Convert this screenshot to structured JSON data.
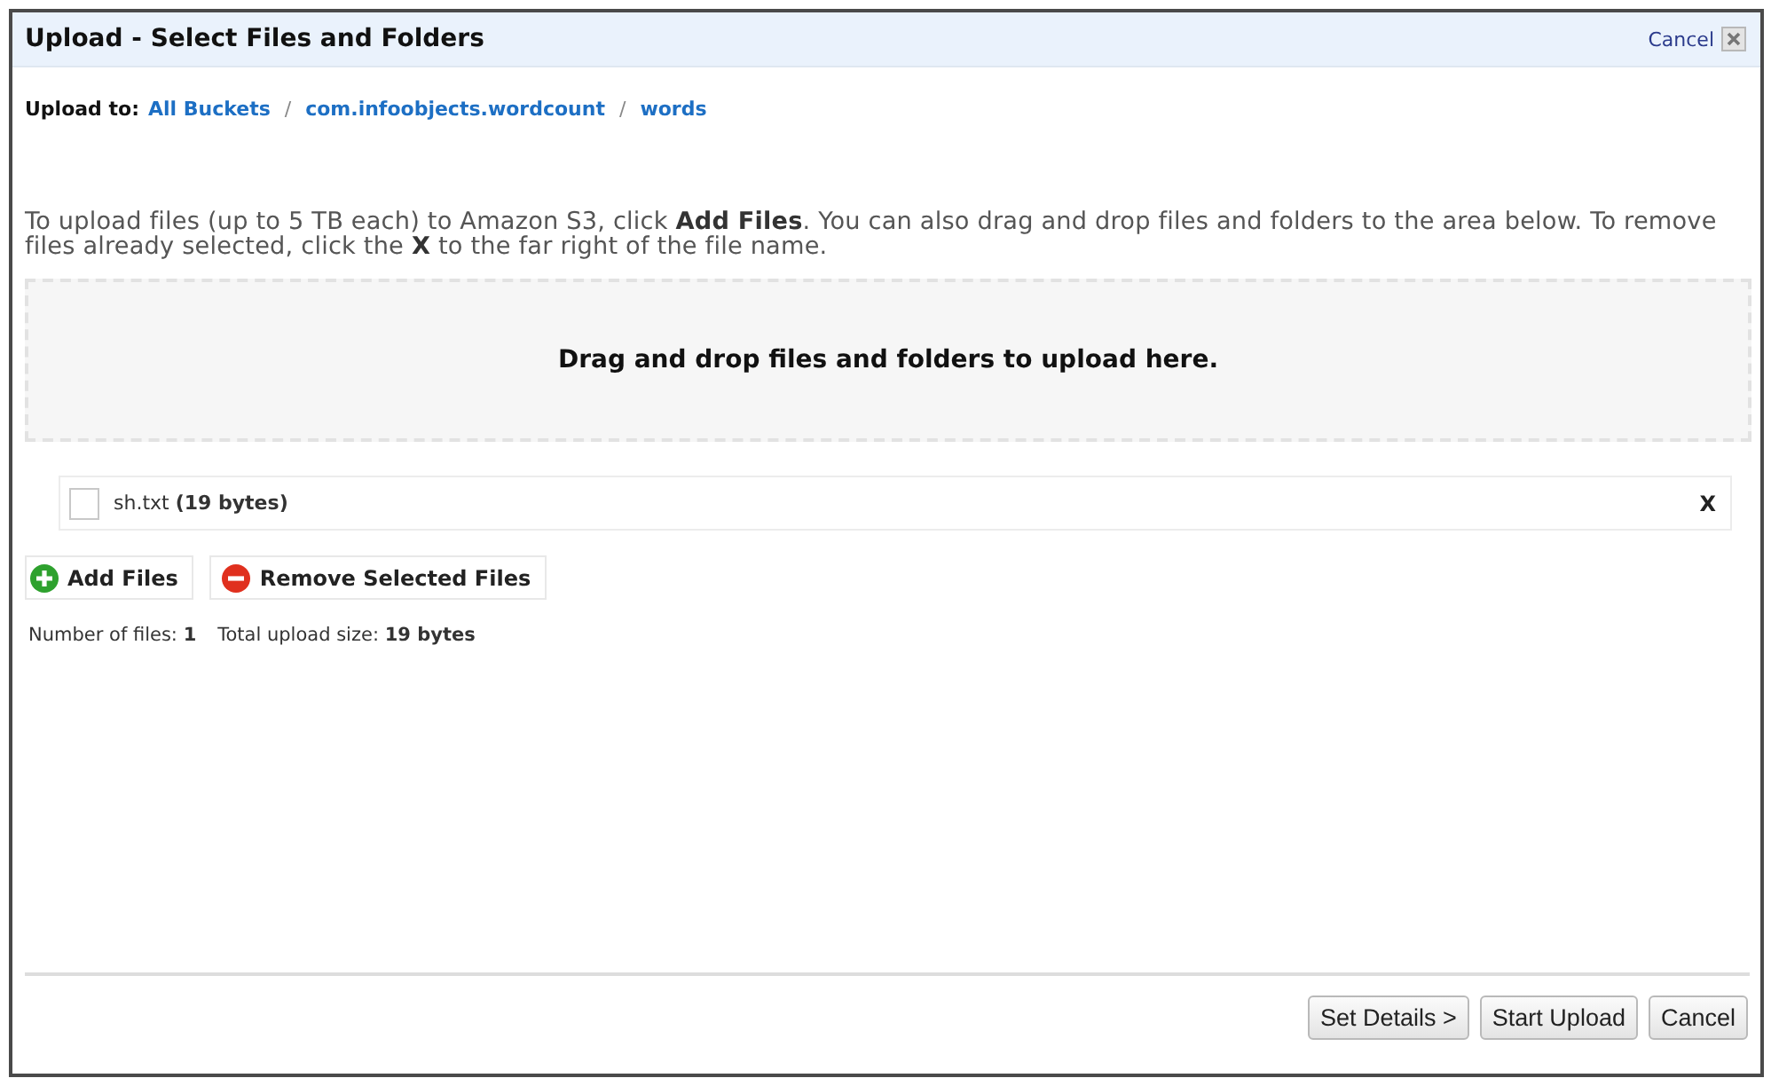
{
  "dialog": {
    "title": "Upload - Select Files and Folders",
    "cancel_link": "Cancel"
  },
  "breadcrumb": {
    "label": "Upload to:",
    "path": [
      {
        "label": "All Buckets"
      },
      {
        "separator": "/",
        "label": "com.infoobjects.wordcount"
      },
      {
        "separator": "/",
        "label": "words"
      }
    ]
  },
  "instructions": "To upload files (up to 5 TB each) to Amazon S3, click **Add Files**. You can also drag and drop files and folders to the area below. To remove files already selected, click the **X** to the far right of the file name.",
  "drop_zone": {
    "text": "Drag and drop files and folders to upload here."
  },
  "files": [
    {
      "label": "sh.txt **(19 bytes)**",
      "checked": false,
      "remove": "X"
    }
  ],
  "actions": [
    {
      "kind": "add",
      "label": "Add Files"
    },
    {
      "kind": "remove",
      "label": "Remove Selected Files"
    }
  ],
  "summary": [
    "Number of files: **1**",
    "Total upload size: **19 bytes**"
  ],
  "footer_buttons": [
    "Set Details >",
    "Start Upload",
    "Cancel"
  ]
}
